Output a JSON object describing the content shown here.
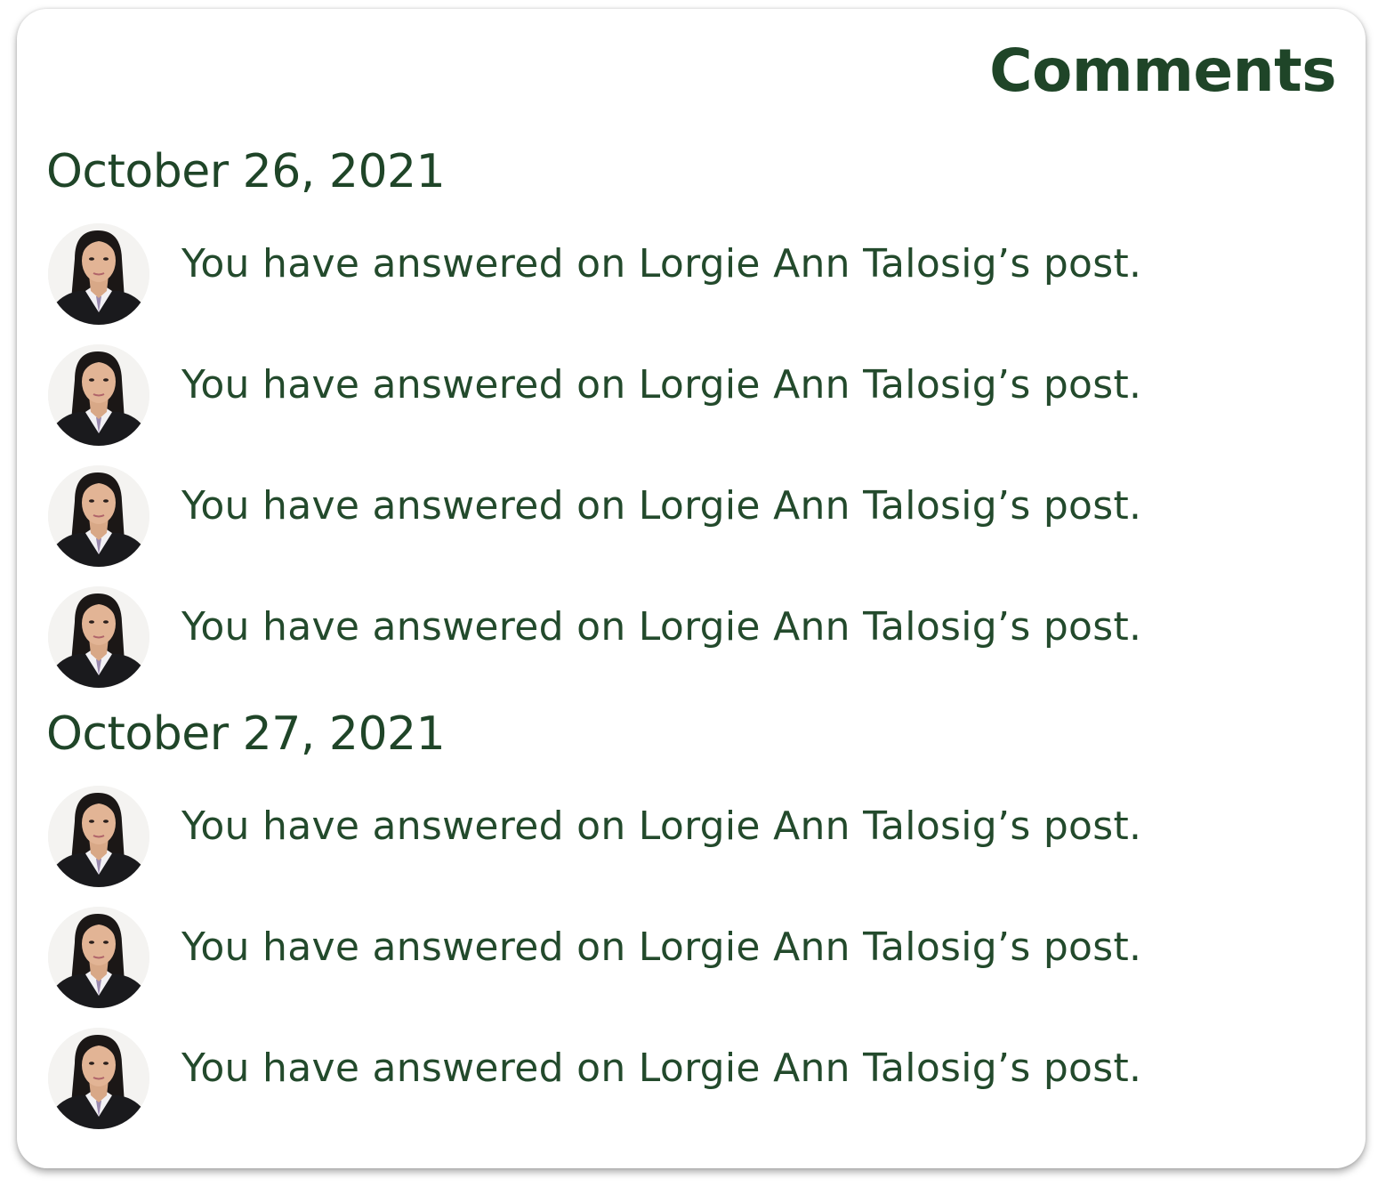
{
  "panel": {
    "title": "Comments"
  },
  "groups": [
    {
      "date": "October 26, 2021",
      "items": [
        {
          "text": "You have answered on Lorgie Ann Talosig’s post."
        },
        {
          "text": "You have answered on Lorgie Ann Talosig’s post."
        },
        {
          "text": "You have answered on Lorgie Ann Talosig’s post."
        },
        {
          "text": "You have answered on Lorgie Ann Talosig’s post."
        }
      ]
    },
    {
      "date": "October 27, 2021",
      "items": [
        {
          "text": "You have answered on Lorgie Ann Talosig’s post."
        },
        {
          "text": "You have answered on Lorgie Ann Talosig’s post."
        },
        {
          "text": "You have answered on Lorgie Ann Talosig’s post."
        }
      ]
    }
  ],
  "colors": {
    "accent": "#1f4528",
    "text": "#234a2c",
    "background": "#ffffff"
  },
  "icons": {
    "avatar": "user-avatar-photo"
  }
}
